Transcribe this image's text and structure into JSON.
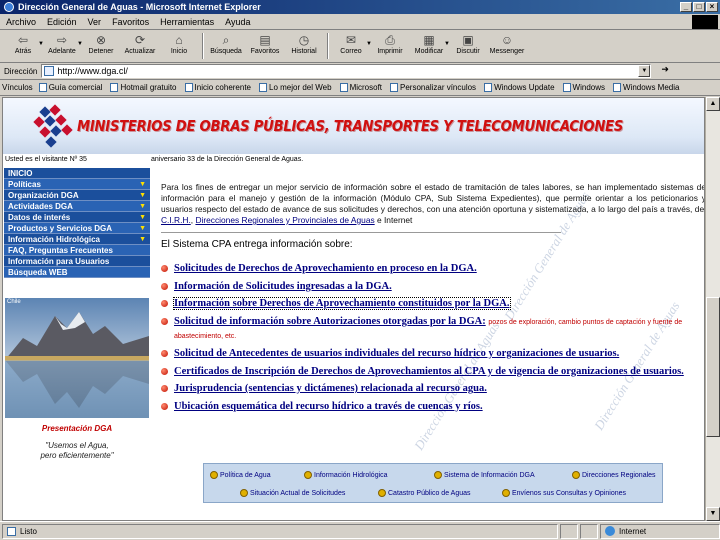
{
  "window": {
    "title": "Dirección General de Aguas - Microsoft Internet Explorer"
  },
  "menu": [
    "Archivo",
    "Edición",
    "Ver",
    "Favoritos",
    "Herramientas",
    "Ayuda"
  ],
  "toolbar": {
    "back": "Atrás",
    "forward": "Adelante",
    "stop": "Detener",
    "refresh": "Actualizar",
    "home": "Inicio",
    "search": "Búsqueda",
    "favorites": "Favoritos",
    "history": "Historial",
    "mail": "Correo",
    "print": "Imprimir",
    "edit": "Modificar",
    "discuss": "Discutir",
    "messenger": "Messenger"
  },
  "address": {
    "label": "Dirección",
    "url": "http://www.dga.cl/"
  },
  "links": {
    "label": "Vínculos",
    "items": [
      "Guía comercial",
      "Hotmail gratuito",
      "Inicio coherente",
      "Lo mejor del Web",
      "Microsoft",
      "Personalizar vínculos",
      "Windows Update",
      "Windows",
      "Windows Media"
    ]
  },
  "banner": {
    "title": "MINISTERIOS DE OBRAS PÚBLICAS, TRANSPORTES Y TELECOMUNICACIONES"
  },
  "subbar": {
    "visitor": "Usted es el visitante Nº 35",
    "anniversary": "aniversario 33 de la Dirección General de Aguas."
  },
  "nav": {
    "items": [
      {
        "label": "INICIO",
        "arrow": false
      },
      {
        "label": "Políticas",
        "arrow": true
      },
      {
        "label": "Organización DGA",
        "arrow": true
      },
      {
        "label": "Actividades DGA",
        "arrow": true
      },
      {
        "label": "Datos de interés",
        "arrow": true
      },
      {
        "label": "Productos y Servicios DGA",
        "arrow": true
      },
      {
        "label": "Información Hidrológica",
        "arrow": true
      },
      {
        "label": "FAQ, Preguntas Frecuentes",
        "arrow": false
      },
      {
        "label": "Información para Usuarios",
        "arrow": false
      },
      {
        "label": "Búsqueda WEB",
        "arrow": false
      }
    ]
  },
  "photo_label": "Chile",
  "presentation": "Presentación DGA",
  "quote": {
    "line1": "\"Usemos el Agua,",
    "line2": "pero eficientemente\""
  },
  "intro": {
    "text": "Para los fines de entregar un mejor servicio de información sobre el estado de tramitación de tales labores, se han implementado sistemas de información para el manejo y gestión de la información (Módulo CPA, Sub Sistema Expedientes), que permite orientar a los peticionarios y usuarios respecto del estado de avance de sus solicitudes y derechos, con una atención oportuna y sistematizada, a lo largo del país a través, del",
    "link1": "C.I.R.H.",
    "mid": ",",
    "link2": "Direcciones Regionales y Provinciales de Aguas",
    "tail": "e Internet"
  },
  "section_title": "El Sistema CPA entrega información sobre:",
  "services": [
    {
      "text": "Solicitudes de Derechos de Aprovechamiento en proceso en la DGA.",
      "note": ""
    },
    {
      "text": "Información de Solicitudes ingresadas a la DGA.",
      "note": ""
    },
    {
      "text": "Información sobre Derechos de Aprovechamiento constituidos por la DGA.",
      "note": ""
    },
    {
      "text": "Solicitud de información sobre Autorizaciones otorgadas por la DGA:",
      "note": "pozos de exploración, cambio puntos de captación y fuente de abastecimiento, etc."
    },
    {
      "text": "Solicitud de Antecedentes de usuarios individuales del recurso hídrico y organizaciones de usuarios.",
      "note": ""
    },
    {
      "text": "Certificados de Inscripción de Derechos de Aprovechamientos al CPA y de vigencia de organizaciones de usuarios.",
      "note": ""
    },
    {
      "text": "Jurisprudencia (sentencias y dictámenes) relacionada al recurso agua.",
      "note": ""
    },
    {
      "text": "Ubicación esquemática del recurso hídrico a través de cuencas y ríos.",
      "note": ""
    }
  ],
  "bottom_links": {
    "row1": [
      "Política de Agua",
      "Información Hidrológica",
      "Sistema de Información DGA",
      "Direcciones Regionales"
    ],
    "row2": [
      "Situación Actual de Solicitudes",
      "Catastro Público de Aguas",
      "Envíenos sus Consultas y Opiniones"
    ]
  },
  "watermark": "Dirección General de Aguas",
  "status": {
    "text": "Listo",
    "zone": "Internet"
  }
}
